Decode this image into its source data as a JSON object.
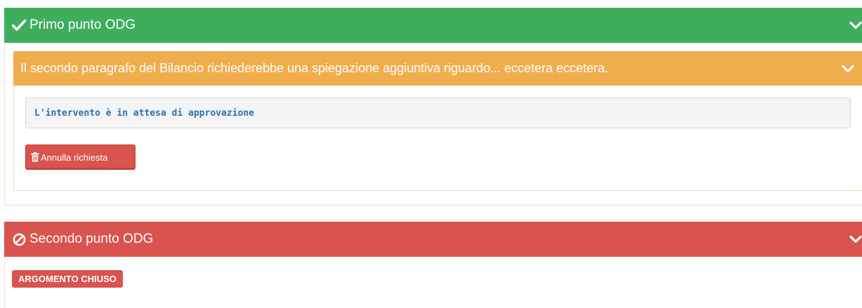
{
  "colors": {
    "success": "#3eae5d",
    "warning": "#f0ad4e",
    "danger": "#d9534f",
    "status_text": "#2f6fa8"
  },
  "items": [
    {
      "title": "Primo punto ODG",
      "status_icon": "check-icon",
      "intervention": {
        "text": "Il secondo paragrafo del Bilancio richiederebbe una spiegazione aggiuntiva riguardo... eccetera eccetera.",
        "status_message": "L'intervento è in attesa di approvazione",
        "cancel_label": "Annulla richiesta",
        "cancel_icon": "trash-icon"
      }
    },
    {
      "title": "Secondo punto ODG",
      "status_icon": "ban-icon",
      "closed_label": "ARGOMENTO CHIUSO"
    }
  ]
}
